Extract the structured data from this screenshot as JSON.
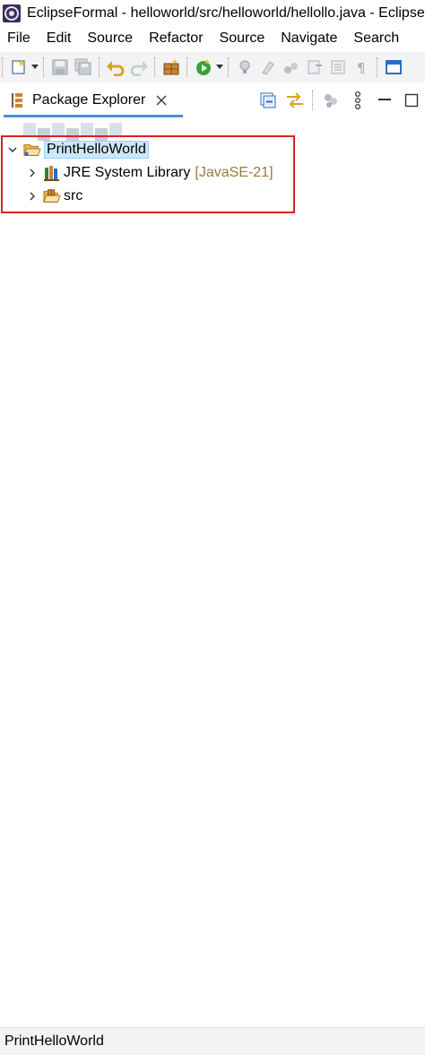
{
  "window": {
    "title": "EclipseFormal - helloworld/src/helloworld/hellollo.java - Eclipse IDE"
  },
  "menu": {
    "items": [
      "File",
      "Edit",
      "Source",
      "Refactor",
      "Source",
      "Navigate",
      "Search"
    ]
  },
  "view": {
    "tab_label": "Package Explorer",
    "actions": [
      "collapse-all-icon",
      "link-with-editor-icon",
      "filters-icon",
      "view-menu-icon",
      "minimize-icon",
      "maximize-icon"
    ]
  },
  "tree": {
    "project": "PrintHelloWorld",
    "children": [
      {
        "label": "JRE System Library",
        "decoration": "[JavaSE-21]",
        "icon": "library-icon"
      },
      {
        "label": "src",
        "icon": "source-folder-icon"
      }
    ]
  },
  "status": {
    "text": "PrintHelloWorld"
  },
  "colors": {
    "selection": "#cce8ff",
    "highlight_border": "#e02020",
    "decoration": "#9c7a3c",
    "tab_underline": "#4a90d9"
  }
}
